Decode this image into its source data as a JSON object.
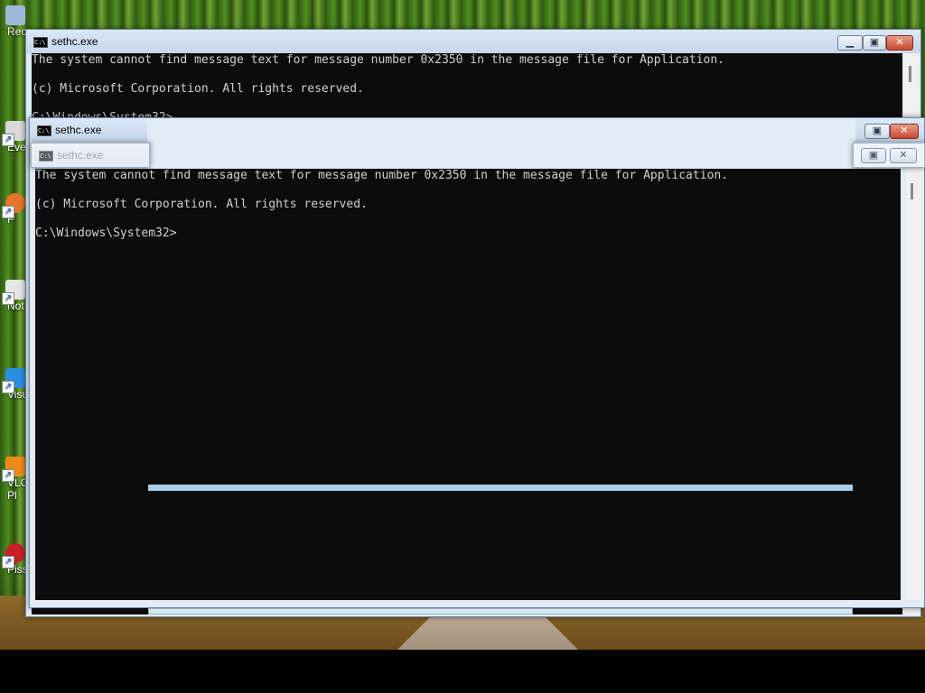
{
  "desktop": {
    "icons": [
      {
        "label": "Rec",
        "icon": "recycle-bin-icon",
        "color": "#9fb7d8"
      },
      {
        "label": "Eve",
        "icon": "shortcut-icon",
        "color": "#d9d9d9"
      },
      {
        "label": "F",
        "icon": "firefox-icon",
        "color": "#e8742a"
      },
      {
        "label": "Not",
        "icon": "notepad-icon",
        "color": "#e6e6e6"
      },
      {
        "label": "Visu",
        "icon": "visual-studio-code-icon",
        "color": "#2b8fe0"
      },
      {
        "label": "VLC",
        "label2": "Pl",
        "icon": "vlc-icon",
        "color": "#f08a1c"
      },
      {
        "label": "Pissar",
        "icon": "pissarro-icon",
        "color": "#c8202a"
      }
    ]
  },
  "windows": {
    "main": {
      "title": "sethc.exe",
      "lines": [
        "The system cannot find message text for message number 0x2350 in the message file for Application.",
        "",
        "(c) Microsoft Corporation. All rights reserved.",
        "",
        "C:\\Windows\\System32>"
      ]
    },
    "second": {
      "title": "sethc.exe",
      "lines": [
        "The system cannot find message text for message number 0x2350 in the message file for Application.",
        "",
        "(c) Microsoft Corporation. All rights reserved.",
        "",
        "C:\\Windows\\System32>"
      ]
    },
    "third": {
      "title": "sethc.exe"
    }
  },
  "colors": {
    "console_bg": "#0c0c0c",
    "console_fg": "#cfcfcf",
    "frame": "#e1ecf7",
    "close": "#c74a32"
  }
}
